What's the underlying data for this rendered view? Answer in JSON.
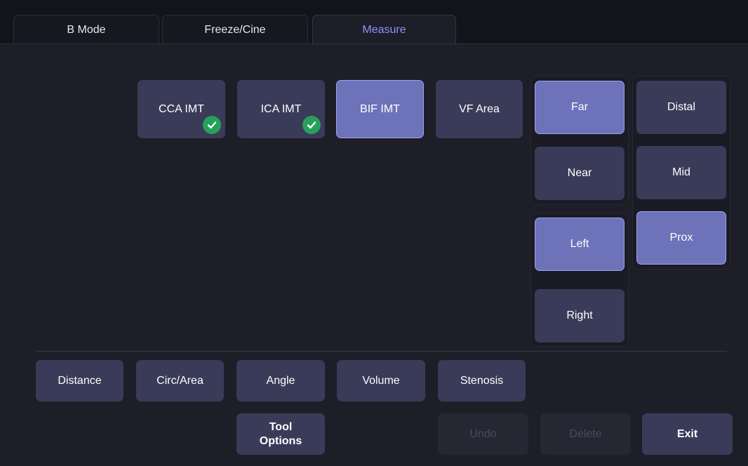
{
  "tabs": [
    {
      "label": "B Mode"
    },
    {
      "label": "Freeze/Cine"
    },
    {
      "label": "Measure"
    }
  ],
  "measure_items": [
    {
      "label": "CCA IMT",
      "done": true
    },
    {
      "label": "ICA IMT",
      "done": true
    },
    {
      "label": "BIF IMT",
      "selected": true
    },
    {
      "label": "VF Area"
    }
  ],
  "depth_group": [
    "Far",
    "Near"
  ],
  "side_group": [
    "Left",
    "Right"
  ],
  "segment_group": [
    "Distal",
    "Mid",
    "Prox"
  ],
  "tools": [
    "Distance",
    "Circ/Area",
    "Angle",
    "Volume",
    "Stenosis"
  ],
  "bottom": {
    "tool_options_line1": "Tool",
    "tool_options_line2": "Options",
    "undo": "Undo",
    "delete": "Delete",
    "exit": "Exit"
  },
  "colors": {
    "accent": "#8d93ff",
    "selected_button": "#6d72b9",
    "button": "#3a3b58",
    "check": "#27a05a"
  },
  "icons": {
    "check": "check-icon"
  }
}
